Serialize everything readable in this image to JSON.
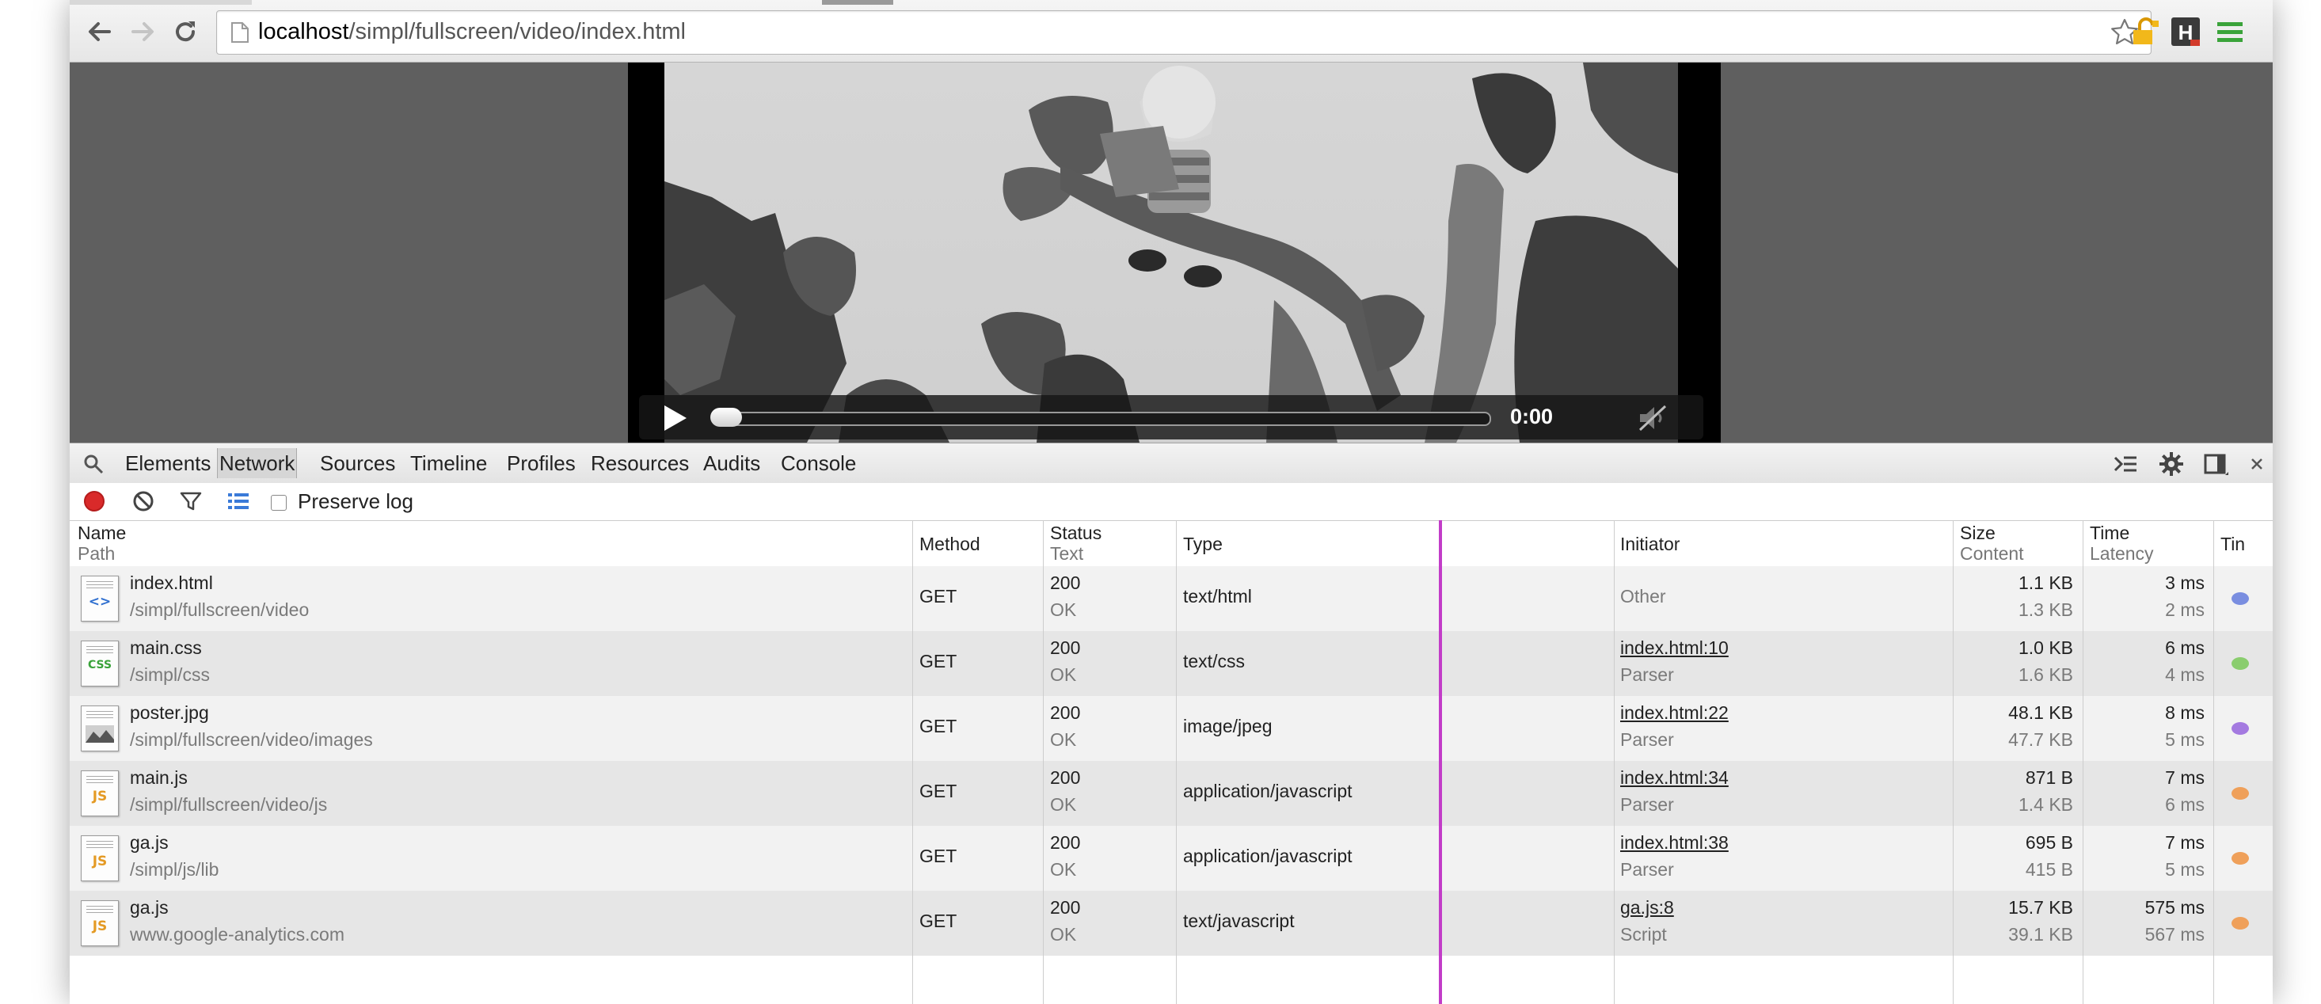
{
  "browser": {
    "url_host": "localhost",
    "url_path": "/simpl/fullscreen/video/index.html",
    "toolbar_icons": [
      "back-arrow-icon",
      "forward-arrow-icon",
      "reload-icon",
      "page-icon",
      "star-icon",
      "lock-extension-icon",
      "h-extension-icon",
      "menu-icon"
    ]
  },
  "video": {
    "time": "0:00",
    "progress": 0
  },
  "devtools": {
    "tabs": [
      "Elements",
      "Network",
      "Sources",
      "Timeline",
      "Profiles",
      "Resources",
      "Audits",
      "Console"
    ],
    "active_tab": "Network",
    "preserve_log_label": "Preserve log",
    "preserve_log_checked": false
  },
  "network": {
    "headers": {
      "name": "Name",
      "path": "Path",
      "method": "Method",
      "status": "Status",
      "text": "Text",
      "type": "Type",
      "initiator": "Initiator",
      "size": "Size",
      "content": "Content",
      "time": "Time",
      "latency": "Latency",
      "timeline": "Tin"
    },
    "rows": [
      {
        "name": "index.html",
        "path": "/simpl/fullscreen/video",
        "method": "GET",
        "status": "200",
        "text": "OK",
        "type": "text/html",
        "initiator": "Other",
        "initiator_sub": "",
        "size": "1.1 KB",
        "content": "1.3 KB",
        "time": "3 ms",
        "latency": "2 ms",
        "icon": "html",
        "color": "#7a8ee0"
      },
      {
        "name": "main.css",
        "path": "/simpl/css",
        "method": "GET",
        "status": "200",
        "text": "OK",
        "type": "text/css",
        "initiator": "index.html:10",
        "initiator_sub": "Parser",
        "size": "1.0 KB",
        "content": "1.6 KB",
        "time": "6 ms",
        "latency": "4 ms",
        "icon": "CSS",
        "color": "#8acd6e"
      },
      {
        "name": "poster.jpg",
        "path": "/simpl/fullscreen/video/images",
        "method": "GET",
        "status": "200",
        "text": "OK",
        "type": "image/jpeg",
        "initiator": "index.html:22",
        "initiator_sub": "Parser",
        "size": "48.1 KB",
        "content": "47.7 KB",
        "time": "8 ms",
        "latency": "5 ms",
        "icon": "image",
        "color": "#a47ae0"
      },
      {
        "name": "main.js",
        "path": "/simpl/fullscreen/video/js",
        "method": "GET",
        "status": "200",
        "text": "OK",
        "type": "application/javascript",
        "initiator": "index.html:34",
        "initiator_sub": "Parser",
        "size": "871 B",
        "content": "1.4 KB",
        "time": "7 ms",
        "latency": "6 ms",
        "icon": "JS",
        "color": "#efa05a"
      },
      {
        "name": "ga.js",
        "path": "/simpl/js/lib",
        "method": "GET",
        "status": "200",
        "text": "OK",
        "type": "application/javascript",
        "initiator": "index.html:38",
        "initiator_sub": "Parser",
        "size": "695 B",
        "content": "415 B",
        "time": "7 ms",
        "latency": "5 ms",
        "icon": "JS",
        "color": "#efa05a"
      },
      {
        "name": "ga.js",
        "path": "www.google-analytics.com",
        "method": "GET",
        "status": "200",
        "text": "OK",
        "type": "text/javascript",
        "initiator": "ga.js:8",
        "initiator_sub": "Script",
        "size": "15.7 KB",
        "content": "39.1 KB",
        "time": "575 ms",
        "latency": "567 ms",
        "icon": "JS",
        "color": "#efa05a"
      }
    ]
  }
}
